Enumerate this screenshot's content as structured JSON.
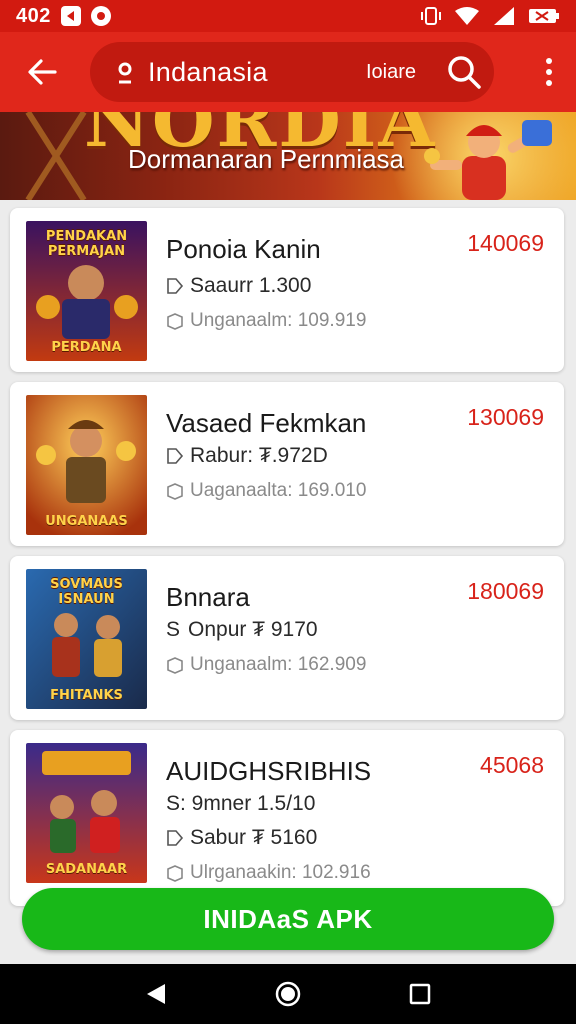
{
  "status_bar": {
    "time": "402"
  },
  "app_bar": {
    "title": "Indanasia",
    "extra": "Ioiare"
  },
  "banner": {
    "headline": "NORDIA",
    "subtitle": "Dormanaran Pernmiasa"
  },
  "items": [
    {
      "name": "Ponoia Kanin",
      "price": "140069",
      "meta1": "Saaurr 1.300",
      "meta2": "Unganaalm: 109.919",
      "thumb_top": "PENDAKAN PERMAJAN",
      "thumb_bottom": "PERDANA"
    },
    {
      "name": "Vasaed Fekmkan",
      "price": "130069",
      "meta1": "Rabur: ₮.972D",
      "meta2": "Uaganaalta: 169.010",
      "thumb_top": "",
      "thumb_bottom": "UNGANAAS"
    },
    {
      "name": "Bnnara",
      "price": "180069",
      "meta1": "Onpur ₮ 9170",
      "meta1_prefix": "S",
      "meta2": "Unganaalm: 162.909",
      "thumb_top": "SOVMAUS ISNAUN",
      "thumb_bottom": "FHITANKS"
    },
    {
      "name": "AUIDGHSRIBHIS",
      "price": "45068",
      "meta0": "S: 9mner 1.5/10",
      "meta1": "Sabur ₮ 5160",
      "meta2": "Ulrganaakin: 102.916",
      "thumb_top": "",
      "thumb_bottom": "SADANAAR"
    }
  ],
  "install_button": {
    "label": "INIDAaS APK"
  },
  "colors": {
    "primary": "#e0271b",
    "price": "#d8231a",
    "install": "#18b818"
  },
  "icons": [
    "back-arrow-icon",
    "location-icon",
    "search-icon",
    "more-vert-icon",
    "tag-icon",
    "box-icon",
    "nav-back-icon",
    "nav-home-icon",
    "nav-recents-icon"
  ]
}
